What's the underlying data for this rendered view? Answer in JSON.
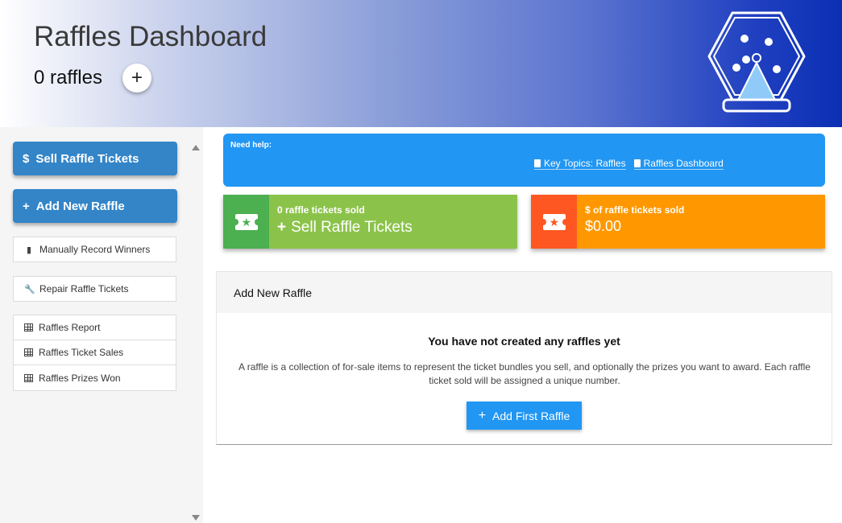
{
  "header": {
    "title": "Raffles Dashboard",
    "raffle_count": "0 raffles",
    "add_label": "+",
    "logo_icon": "raffle-drum-icon"
  },
  "sidebar": {
    "sell_button": {
      "icon": "$",
      "label": "Sell Raffle Tickets"
    },
    "add_button": {
      "icon": "+",
      "label": "Add New Raffle"
    },
    "record_winners": "Manually Record Winners",
    "repair_tickets": "Repair Raffle Tickets",
    "reports": [
      {
        "label": "Raffles Report"
      },
      {
        "label": "Raffles Ticket Sales"
      },
      {
        "label": "Raffles Prizes Won"
      }
    ]
  },
  "help": {
    "title": "Need help:",
    "links": [
      {
        "label": "Key Topics: Raffles"
      },
      {
        "label": "Raffles Dashboard"
      }
    ]
  },
  "cards": {
    "sold": {
      "label": "0 raffle tickets sold",
      "action": "Sell Raffle Tickets",
      "action_icon": "+"
    },
    "revenue": {
      "label": "$ of raffle tickets sold",
      "amount": "$0.00"
    }
  },
  "panel": {
    "title": "Add New Raffle",
    "empty_title": "You have not created any raffles yet",
    "empty_desc": "A raffle is a collection of for-sale items to represent the ticket bundles you sell, and optionally the prizes you want to award. Each raffle ticket sold will be assigned a unique number.",
    "button_label": "Add First Raffle",
    "button_icon": "+"
  },
  "colors": {
    "primary_blue": "#2196f3",
    "sidebar_button": "#3385c8",
    "green": "#8bc34a",
    "dark_green": "#4caf50",
    "orange": "#ff9800",
    "deep_orange": "#ff5722"
  }
}
